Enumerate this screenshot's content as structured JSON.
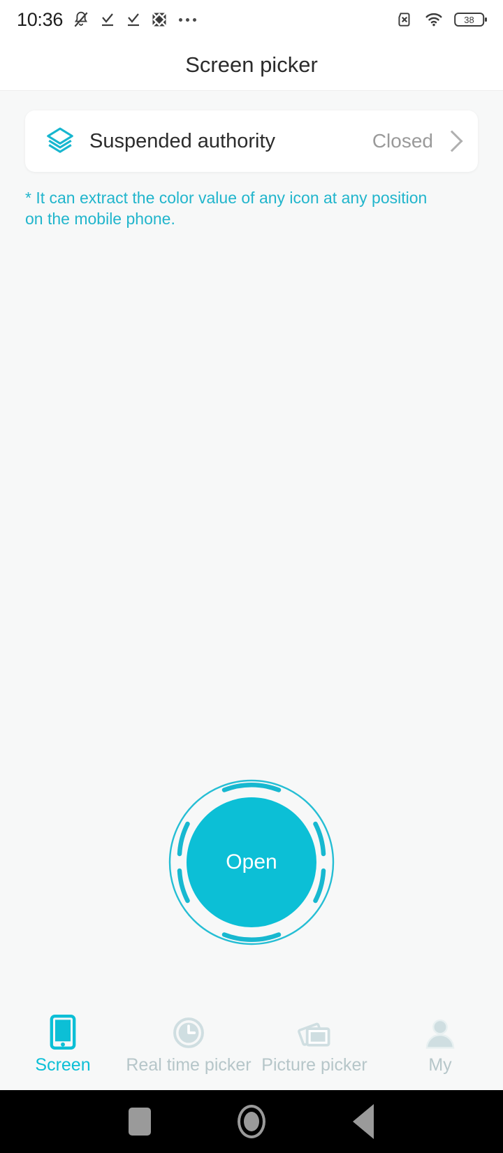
{
  "statusbar": {
    "time": "10:36",
    "left_icons": [
      "bell-muted-icon",
      "check-download-icon",
      "check-download-icon",
      "image-broken-icon",
      "overflow-dots-icon"
    ],
    "right_icons": [
      "no-sim-icon",
      "wifi-icon",
      "battery-icon"
    ],
    "battery_level": "38"
  },
  "header": {
    "title": "Screen picker"
  },
  "card": {
    "icon": "layers-icon",
    "label": "Suspended authority",
    "value": "Closed",
    "chevron": "chevron-right-icon"
  },
  "hint": {
    "text": "* It can extract the color value of any icon at any position on the mobile phone."
  },
  "open_button": {
    "label": "Open"
  },
  "tabs": [
    {
      "label": "Screen",
      "icon": "phone-screen-icon",
      "active": true
    },
    {
      "label": "Real time picker",
      "icon": "clock-icon",
      "active": false
    },
    {
      "label": "Picture picker",
      "icon": "photos-stack-icon",
      "active": false
    },
    {
      "label": "My",
      "icon": "person-icon",
      "active": false
    }
  ],
  "android_nav": {
    "recents": "square-recents-icon",
    "home": "circle-home-icon",
    "back": "triangle-back-icon"
  },
  "colors": {
    "accent": "#0cbfd6",
    "hint_text": "#21b5cc",
    "tab_inactive": "#b6c6c9",
    "background": "#f7f8f8",
    "surface": "#ffffff"
  }
}
